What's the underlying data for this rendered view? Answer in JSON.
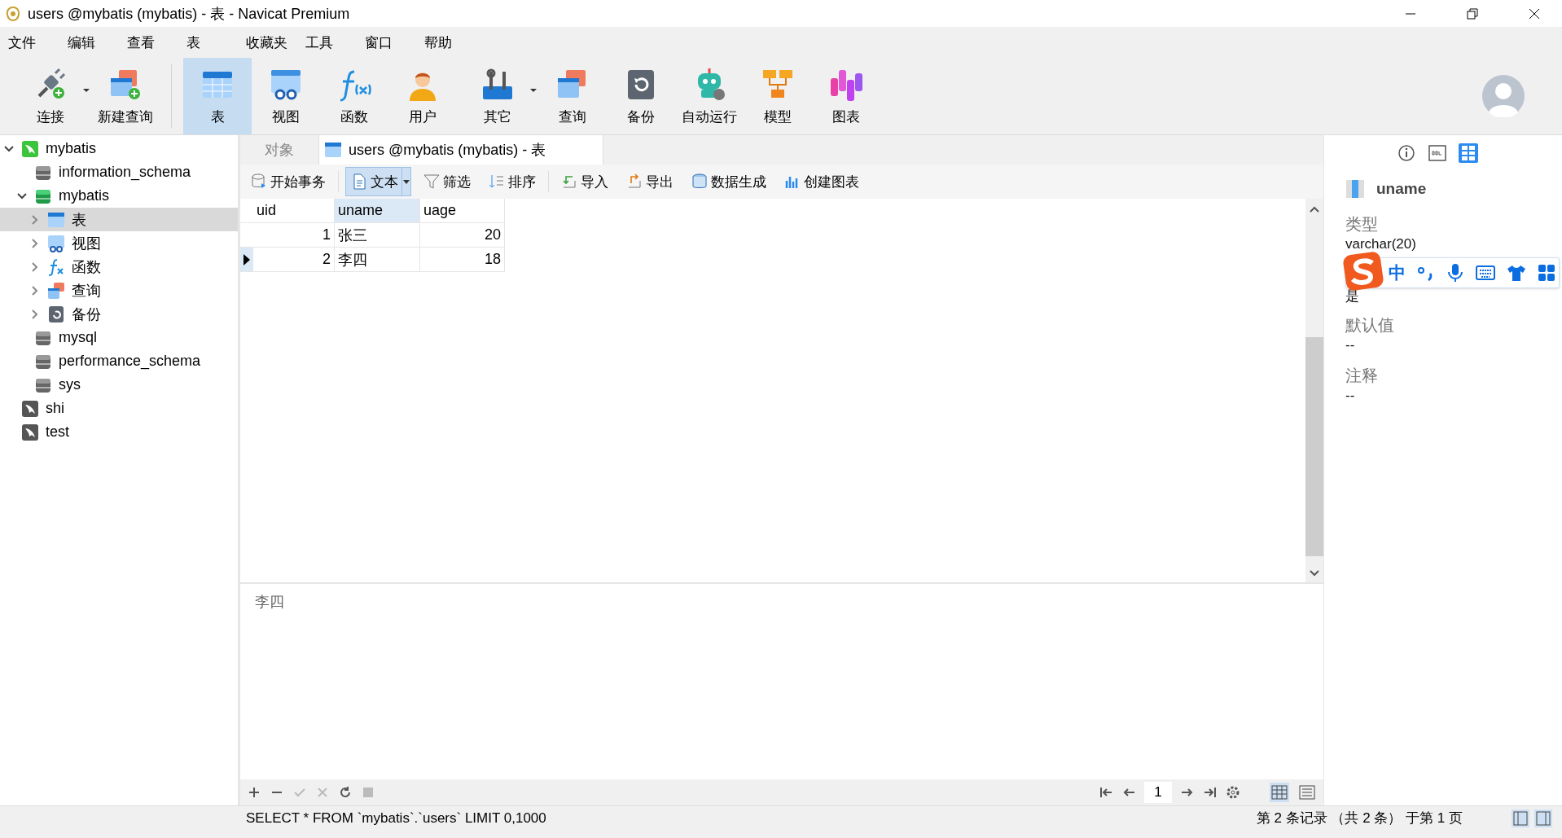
{
  "window": {
    "title": "users @mybatis (mybatis) - 表 - Navicat Premium"
  },
  "menu": [
    "文件",
    "编辑",
    "查看",
    "表",
    "收藏夹",
    "工具",
    "窗口",
    "帮助"
  ],
  "toolbar": [
    {
      "kind": "connection",
      "label": "连接",
      "selected": false,
      "dropdown": true
    },
    {
      "kind": "query-new",
      "label": "新建查询",
      "selected": false,
      "dropdown": false
    },
    {
      "kind": "table",
      "label": "表",
      "selected": true,
      "dropdown": false
    },
    {
      "kind": "view",
      "label": "视图",
      "selected": false,
      "dropdown": false
    },
    {
      "kind": "function",
      "label": "函数",
      "selected": false,
      "dropdown": false
    },
    {
      "kind": "user",
      "label": "用户",
      "selected": false,
      "dropdown": false
    },
    {
      "kind": "other",
      "label": "其它",
      "selected": false,
      "dropdown": true
    },
    {
      "kind": "query",
      "label": "查询",
      "selected": false,
      "dropdown": false
    },
    {
      "kind": "backup",
      "label": "备份",
      "selected": false,
      "dropdown": false
    },
    {
      "kind": "robot",
      "label": "自动运行",
      "selected": false,
      "dropdown": false
    },
    {
      "kind": "model",
      "label": "模型",
      "selected": false,
      "dropdown": false
    },
    {
      "kind": "chart",
      "label": "图表",
      "selected": false,
      "dropdown": false
    }
  ],
  "tree": [
    {
      "kind": "connection",
      "label": "mybatis",
      "expanded": true,
      "selected": false,
      "active": true,
      "children": [
        {
          "kind": "database",
          "label": "information_schema",
          "selected": false,
          "active": false
        },
        {
          "kind": "database",
          "label": "mybatis",
          "expanded": true,
          "selected": false,
          "active": true,
          "children": [
            {
              "kind": "table",
              "label": "表",
              "expanded": false,
              "selected": true
            },
            {
              "kind": "view",
              "label": "视图",
              "expanded": false,
              "selected": false
            },
            {
              "kind": "function",
              "label": "函数",
              "expanded": false,
              "selected": false
            },
            {
              "kind": "query",
              "label": "查询",
              "expanded": false,
              "selected": false
            },
            {
              "kind": "backup",
              "label": "备份",
              "expanded": false,
              "selected": false
            }
          ]
        },
        {
          "kind": "database",
          "label": "mysql",
          "selected": false,
          "active": false
        },
        {
          "kind": "database",
          "label": "performance_schema",
          "selected": false,
          "active": false
        },
        {
          "kind": "database",
          "label": "sys",
          "selected": false,
          "active": false
        }
      ]
    },
    {
      "kind": "connection",
      "label": "shi",
      "selected": false,
      "active": false
    },
    {
      "kind": "connection",
      "label": "test",
      "selected": false,
      "active": false
    }
  ],
  "tabs": [
    {
      "label": "对象",
      "selected": false
    },
    {
      "label": "users @mybatis (mybatis) - 表",
      "selected": true
    }
  ],
  "data_toolbar": [
    {
      "kind": "transaction",
      "label": "开始事务",
      "selected": false,
      "dropdown": false
    },
    {
      "kind": "text",
      "label": "文本",
      "selected": true,
      "dropdown": true
    },
    {
      "kind": "filter",
      "label": "筛选",
      "selected": false,
      "dropdown": false
    },
    {
      "kind": "sort",
      "label": "排序",
      "selected": false,
      "dropdown": false
    },
    {
      "kind": "import",
      "label": "导入",
      "selected": false,
      "dropdown": false
    },
    {
      "kind": "export",
      "label": "导出",
      "selected": false,
      "dropdown": false
    },
    {
      "kind": "generate",
      "label": "数据生成",
      "selected": false,
      "dropdown": false
    },
    {
      "kind": "chart",
      "label": "创建图表",
      "selected": false,
      "dropdown": false
    }
  ],
  "table": {
    "columns": [
      {
        "label": "uid",
        "selected": false
      },
      {
        "label": "uname",
        "selected": true
      },
      {
        "label": "uage",
        "selected": false
      }
    ],
    "rows": [
      {
        "cells": [
          "1",
          "张三",
          "20"
        ],
        "selected": false
      },
      {
        "cells": [
          "2",
          "李四",
          "18"
        ],
        "selected": true
      }
    ]
  },
  "preview": {
    "text": "李四"
  },
  "pager": {
    "page": "1"
  },
  "status_bar": {
    "sql": "SELECT * FROM `mybatis`.`users` LIMIT 0,1000",
    "records": "第 2 条记录 （共 2 条） 于第 1 页"
  },
  "inspector": {
    "tabs": [
      {
        "kind": "info",
        "selected": false
      },
      {
        "kind": "ddl",
        "selected": false
      },
      {
        "kind": "fields",
        "selected": true
      }
    ],
    "field": "uname",
    "sections": [
      {
        "label": "类型",
        "value": "varchar(20)"
      },
      {
        "value": "是"
      },
      {
        "label": "默认值",
        "value": "--"
      },
      {
        "label": "注释",
        "value": "--"
      }
    ]
  },
  "ime": {
    "label": "中"
  }
}
